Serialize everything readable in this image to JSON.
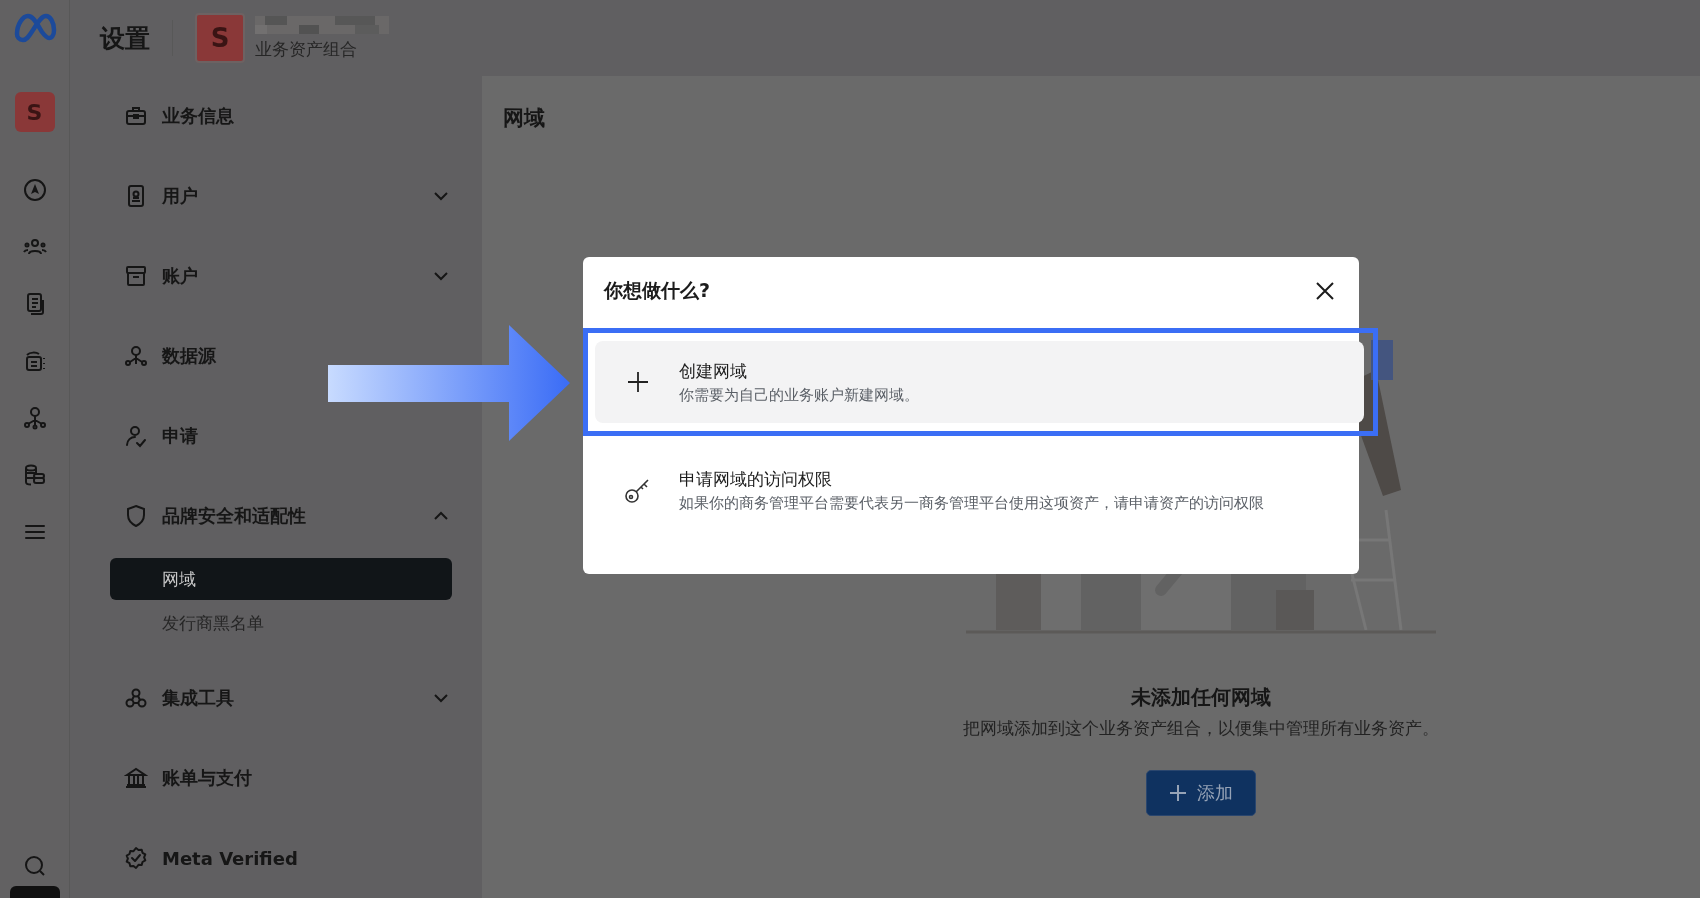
{
  "rail": {
    "avatar_letter": "S"
  },
  "header": {
    "title": "设置",
    "avatar_letter": "S",
    "portfolio_label": "业务资产组合"
  },
  "sidebar": {
    "items": [
      {
        "label": "业务信息"
      },
      {
        "label": "用户",
        "expanded": false
      },
      {
        "label": "账户",
        "expanded": false
      },
      {
        "label": "数据源"
      },
      {
        "label": "申请"
      },
      {
        "label": "品牌安全和适配性",
        "expanded": true,
        "children": [
          {
            "label": "网域",
            "selected": true
          },
          {
            "label": "发行商黑名单",
            "selected": false
          }
        ]
      },
      {
        "label": "集成工具",
        "expanded": false
      },
      {
        "label": "账单与支付"
      },
      {
        "label": "Meta Verified"
      }
    ]
  },
  "main": {
    "title": "网域",
    "empty_state": {
      "title": "未添加任何网域",
      "description": "把网域添加到这个业务资产组合，以便集中管理所有业务资产。",
      "button": "添加"
    }
  },
  "dialog": {
    "title": "你想做什么?",
    "options": [
      {
        "title": "创建网域",
        "description": "你需要为自己的业务账户新建网域。",
        "selected": true
      },
      {
        "title": "申请网域的访问权限",
        "description": "如果你的商务管理平台需要代表另一商务管理平台使用这项资产，请申请资产的访问权限",
        "selected": false
      }
    ]
  }
}
